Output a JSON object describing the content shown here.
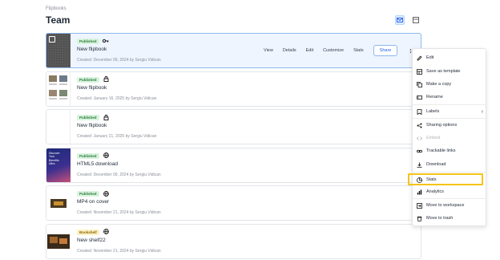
{
  "breadcrumb": "Flipbooks",
  "title": "Team",
  "view": {
    "grid_icon": "grid-icon",
    "list_icon": "list-icon"
  },
  "rows": [
    {
      "badge": "Published",
      "badge_kind": "published",
      "status_icon": "key-icon",
      "name": "New flipbook",
      "created": "Created: December 09, 2024 by Sergiu Vidican",
      "thumb": "dark",
      "selected": true
    },
    {
      "badge": "Published",
      "badge_kind": "published",
      "status_icon": "lock-icon",
      "name": "New flipbook",
      "created": "Created: January 16, 2025 by Sergiu Vidican",
      "thumb": "collage"
    },
    {
      "badge": "Published",
      "badge_kind": "published",
      "status_icon": "lock-icon",
      "name": "New flipbook",
      "created": "Created: January 21, 2025 by Sergiu Vidican",
      "thumb": "white"
    },
    {
      "badge": "Published",
      "badge_kind": "published",
      "status_icon": "globe-icon",
      "name": "HTML5 download",
      "created": "Created: December 09, 2024 by Sergiu Vidican",
      "thumb": "blue",
      "thumb_text": "Discover Your Benefits Ultra"
    },
    {
      "badge": "Published",
      "badge_kind": "published",
      "status_icon": "globe-icon",
      "name": "MP4 on cover",
      "created": "Created: November 21, 2024 by Sergiu Vidican",
      "thumb": "mp4"
    },
    {
      "badge": "Bookshelf",
      "badge_kind": "bookshelf",
      "status_icon": "globe-icon",
      "name": "New shelf22",
      "created": "Created: November 21, 2024 by Sergiu Vidican",
      "thumb": "shelf"
    }
  ],
  "row_actions": [
    "View",
    "Details",
    "Edit",
    "Customize",
    "Stats",
    "Share"
  ],
  "menu": [
    {
      "label": "Edit",
      "icon": "pencil-icon"
    },
    {
      "label": "Save as template",
      "icon": "template-icon"
    },
    {
      "label": "Make a copy",
      "icon": "copy-icon"
    },
    {
      "label": "Rename",
      "icon": "rename-icon"
    },
    {
      "label": "Labels",
      "icon": "label-icon"
    },
    {
      "label": "Sharing options",
      "icon": "share-icon"
    },
    {
      "label": "Embed",
      "icon": "embed-icon"
    },
    {
      "label": "Trackable links",
      "icon": "link-icon"
    },
    {
      "label": "Download",
      "icon": "download-icon"
    },
    {
      "label": "Stats",
      "icon": "stats-icon"
    },
    {
      "label": "Analytics",
      "icon": "analytics-icon"
    },
    {
      "label": "Move to workspace",
      "icon": "workspace-icon"
    },
    {
      "label": "Move to trash",
      "icon": "trash-icon"
    }
  ],
  "colors": {
    "accent": "#2563eb",
    "highlight": "#f5c518",
    "published_bg": "#d9f4de",
    "bookshelf_bg": "#fdf0c4"
  }
}
